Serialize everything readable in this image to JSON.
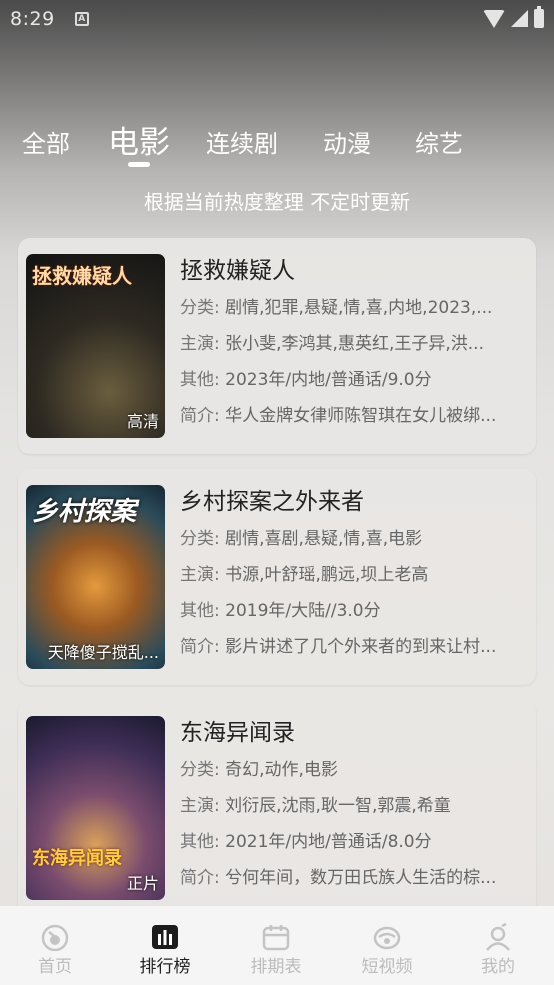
{
  "status_bar": {
    "time": "8:29"
  },
  "tabs": [
    {
      "label": "全部"
    },
    {
      "label": "电影"
    },
    {
      "label": "连续剧"
    },
    {
      "label": "动漫"
    },
    {
      "label": "综艺"
    }
  ],
  "active_tab": "电影",
  "subtitle": "根据当前热度整理 不定时更新",
  "movies": [
    {
      "title": "拯救嫌疑人",
      "poster_text": "拯救嫌疑人",
      "badge": "高清",
      "category_label": "分类:",
      "category": "剧情,犯罪,悬疑,情,喜,内地,2023,...",
      "cast_label": "主演:",
      "cast": "张小斐,李鸿其,惠英红,王子异,洪...",
      "other_label": "其他:",
      "other": "2023年/内地/普通话/9.0分",
      "intro_label": "简介:",
      "intro": "华人金牌女律师陈智琪在女儿被绑..."
    },
    {
      "title": "乡村探案之外来者",
      "poster_text": "乡村探案",
      "badge": "天降傻子搅乱...",
      "category_label": "分类:",
      "category": "剧情,喜剧,悬疑,情,喜,电影",
      "cast_label": "主演:",
      "cast": "书源,叶舒瑶,鹏远,坝上老高",
      "other_label": "其他:",
      "other": "2019年/大陆//3.0分",
      "intro_label": "简介:",
      "intro": "影片讲述了几个外来者的到来让村..."
    },
    {
      "title": "东海异闻录",
      "poster_text": "东海异闻录",
      "badge": "正片",
      "category_label": "分类:",
      "category": "奇幻,动作,电影",
      "cast_label": "主演:",
      "cast": "刘衍辰,沈雨,耿一智,郭震,希童",
      "other_label": "其他:",
      "other": "2021年/内地/普通话/8.0分",
      "intro_label": "简介:",
      "intro": "兮何年间，数万田氏族人生活的棕..."
    }
  ],
  "bottom_nav": [
    {
      "label": "首页",
      "icon": "home-icon"
    },
    {
      "label": "排行榜",
      "icon": "ranking-icon"
    },
    {
      "label": "排期表",
      "icon": "calendar-icon"
    },
    {
      "label": "短视频",
      "icon": "short-video-icon"
    },
    {
      "label": "我的",
      "icon": "profile-icon"
    }
  ],
  "active_nav": "排行榜",
  "colors": {
    "text_dark": "#222222",
    "text_muted": "#666666",
    "nav_inactive": "#bcbcbc"
  }
}
